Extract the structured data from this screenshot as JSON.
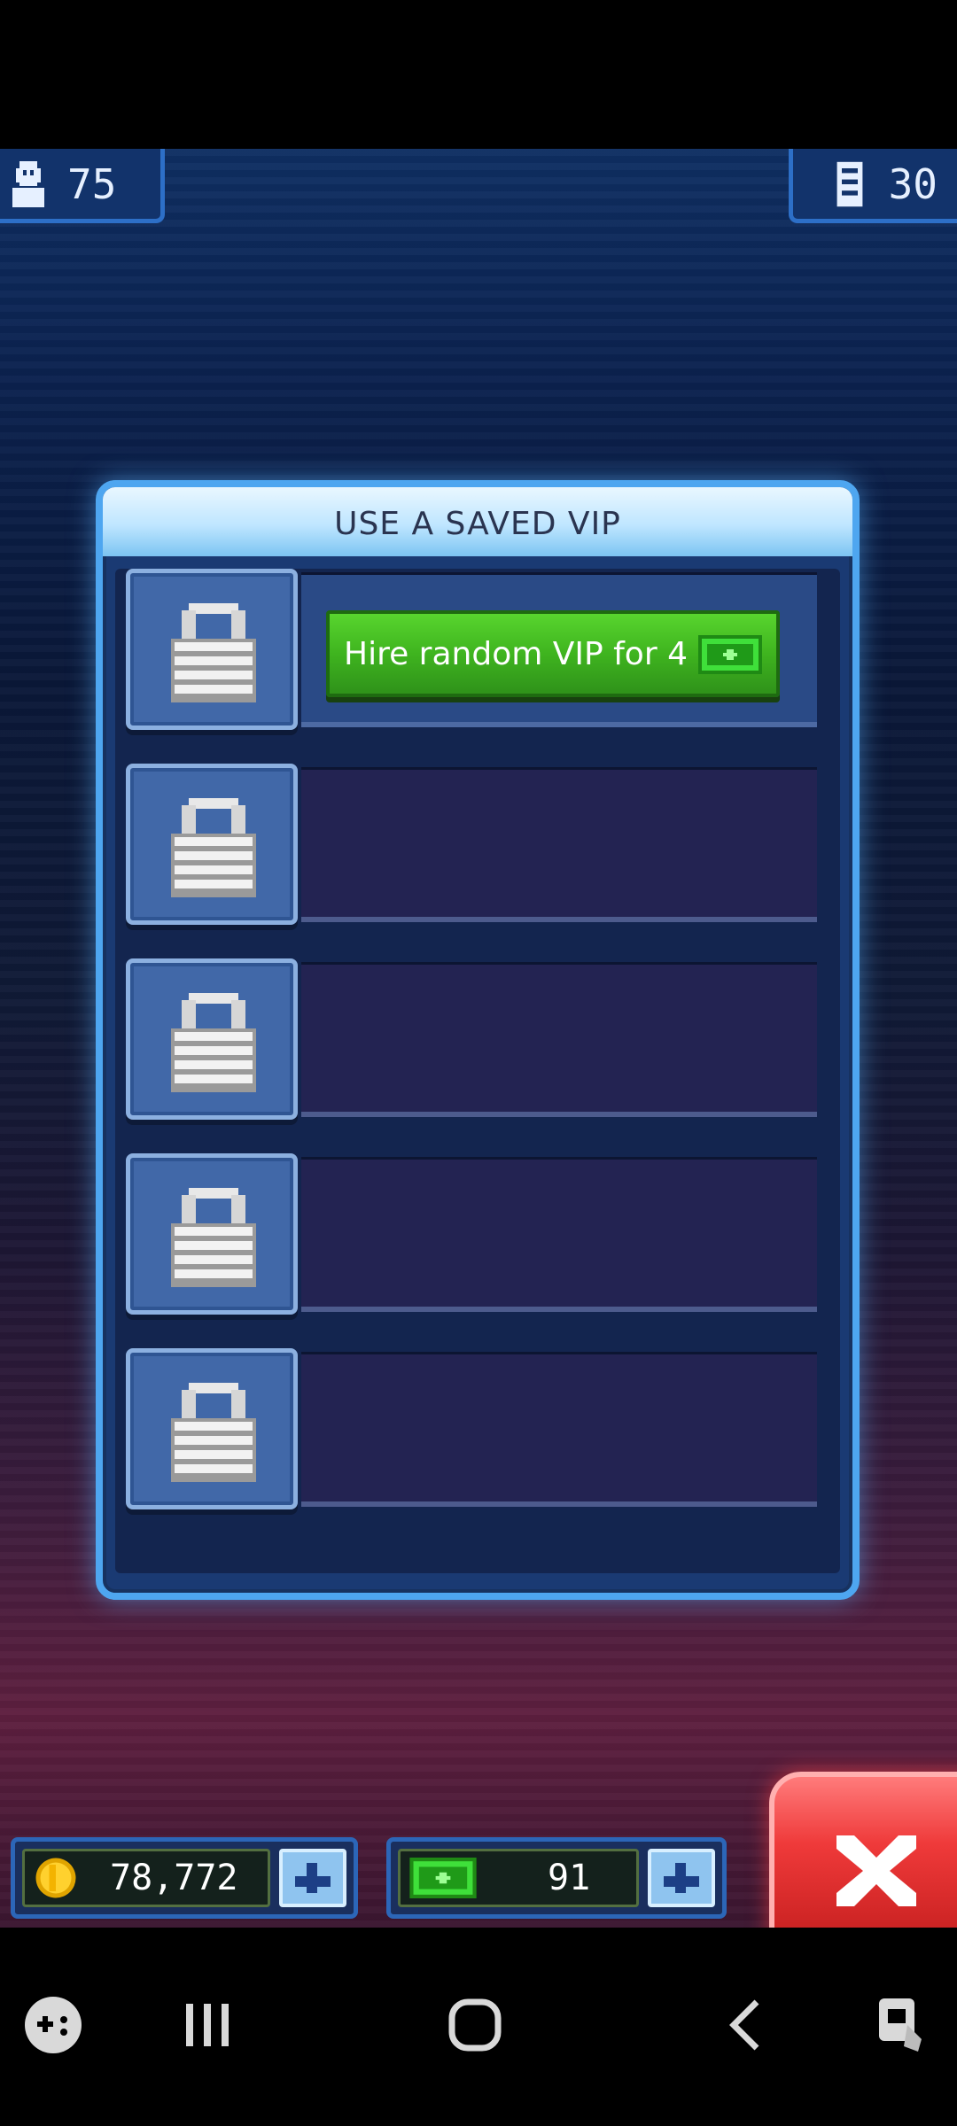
{
  "hud": {
    "population": "75",
    "floors": "30"
  },
  "dialog": {
    "title": "USE A SAVED VIP",
    "hire_label": "Hire random VIP for 4",
    "slots": [
      {
        "locked": true
      },
      {
        "locked": true
      },
      {
        "locked": true
      },
      {
        "locked": true
      },
      {
        "locked": true
      }
    ]
  },
  "currency": {
    "coins": "78,772",
    "bux": "91"
  },
  "icons": {
    "population": "person-icon",
    "floors": "building-icon",
    "coins": "coin-icon",
    "bux": "tower-bux-icon",
    "close": "close-icon",
    "lock": "padlock-icon"
  },
  "colors": {
    "accent": "#4ea6f0",
    "hire_button": "#3fb41f",
    "close_button": "#ef3a3a"
  }
}
